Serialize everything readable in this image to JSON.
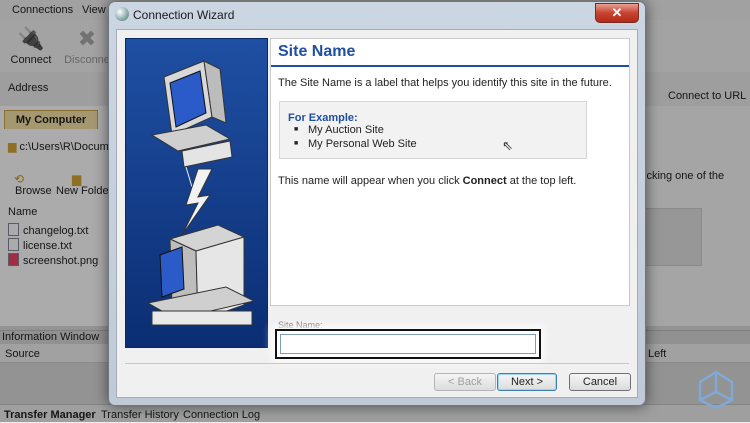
{
  "app": {
    "menu": [
      "Connections",
      "View"
    ],
    "toolbar": {
      "connect": "Connect",
      "disconnect": "Disconne",
      "connect_url": "Connect to URL"
    },
    "address_label": "Address",
    "left_tab": "My Computer",
    "path": "c:\\Users\\R\\Docum",
    "browse": "Browse",
    "new_folder": "New Folder",
    "name_col": "Name",
    "files": [
      "changelog.txt",
      "license.txt",
      "screenshot.png"
    ],
    "right_hint": "icking one of the",
    "info_window": "Information Window",
    "source_col": "Source",
    "left_col": "Left",
    "bottom_tabs": [
      "Transfer Manager",
      "Transfer History",
      "Connection Log"
    ]
  },
  "dialog": {
    "title": "Connection Wizard",
    "close_glyph": "✕",
    "heading": "Site Name",
    "description": "The Site Name is a label that helps you identify this site in the future.",
    "example_title": "For Example:",
    "examples": [
      "My Auction Site",
      "My Personal Web Site"
    ],
    "note_before": "This name will appear when you click ",
    "note_bold": "Connect",
    "note_after": " at the top left.",
    "field_label": "Site Name:",
    "field_value": "",
    "back": "< Back",
    "next": "Next >",
    "cancel": "Cancel"
  },
  "colors": {
    "accent": "#1f4fa3",
    "close": "#c7432f"
  },
  "icons": [
    "connect-icon",
    "disconnect-icon",
    "connect-url-icon",
    "folder-icon",
    "browse-icon",
    "new-folder-icon",
    "file-icon",
    "cursor-icon",
    "computer-icon",
    "lightning-icon",
    "tower-icon",
    "logo-icon"
  ]
}
